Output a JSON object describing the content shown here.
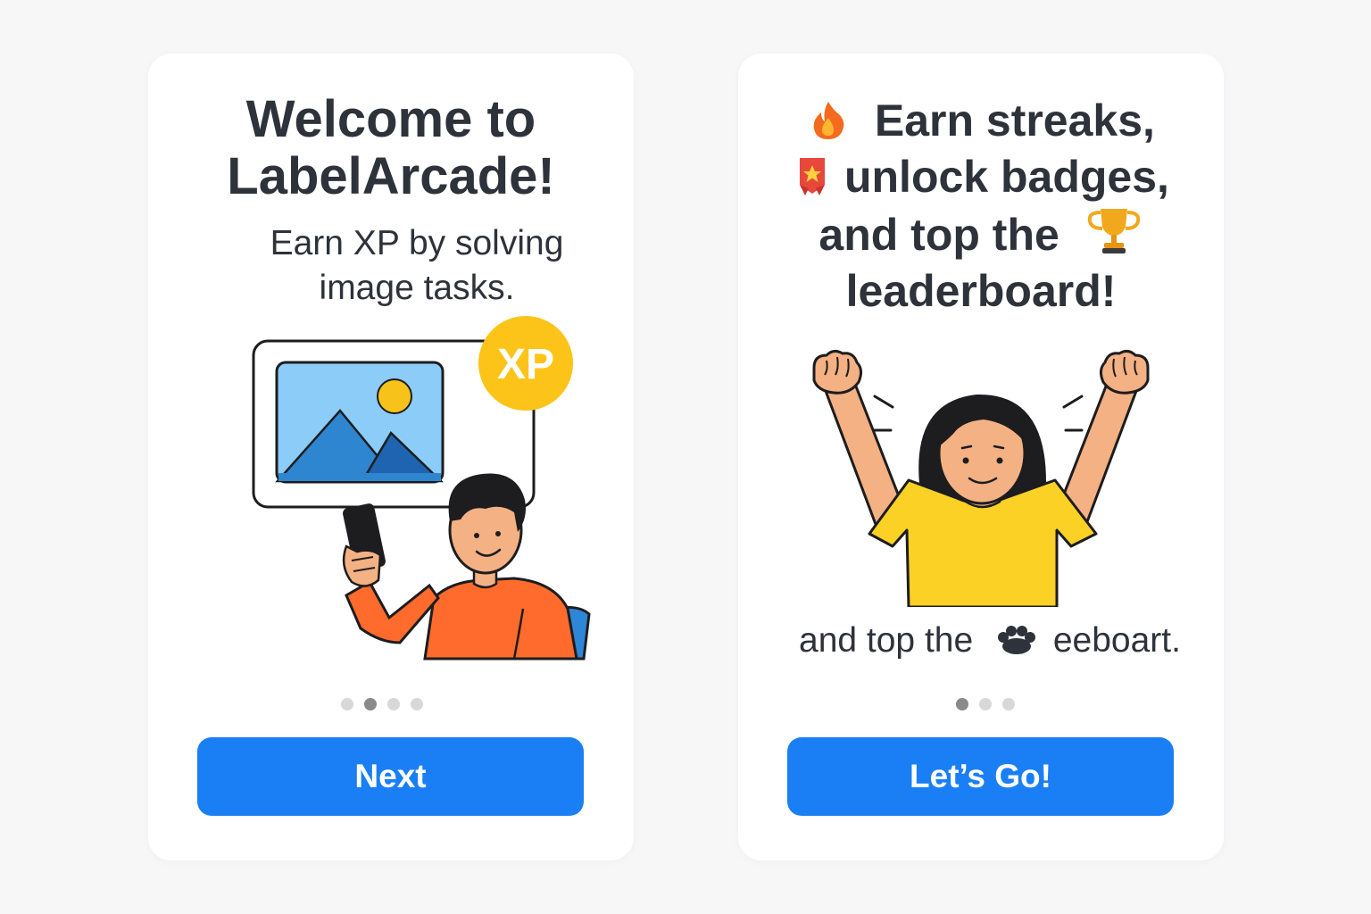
{
  "screens": [
    {
      "title_lines": [
        "Welcome to",
        "LabelArcade!"
      ],
      "subtitle_lines": [
        "Earn XP by solving",
        "image tasks."
      ],
      "xp_badge": "XP",
      "pagination": {
        "total": 4,
        "active": 1
      },
      "button_label": "Next"
    },
    {
      "title_lines": [
        "Earn streaks,",
        "unlock badges,",
        "and top the",
        "leaderboard!"
      ],
      "title_icons": [
        "fire-icon",
        "badge-ribbon-icon",
        "trophy-icon"
      ],
      "caption": {
        "text_before": "and top the",
        "text_after": "eeboart."
      },
      "pagination": {
        "total": 3,
        "active": 0
      },
      "button_label": "Let’s Go!"
    }
  ],
  "colors": {
    "background": "#f7f7f8",
    "card": "#ffffff",
    "primary_button": "#1a7ff5",
    "text": "#2e323a",
    "xp_badge": "#fcc419",
    "dot_inactive": "#d8d8d8",
    "dot_active": "#8a8a8a"
  }
}
